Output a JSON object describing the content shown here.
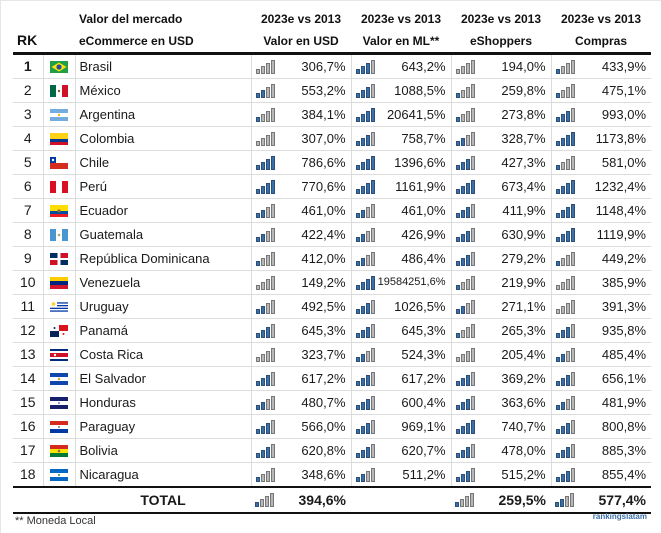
{
  "header": {
    "rk": "RK",
    "name_line1": "Valor del mercado",
    "name_line2": "eCommerce en USD",
    "columns": [
      {
        "line1": "2023e vs 2013",
        "line2": "Valor en USD"
      },
      {
        "line1": "2023e vs 2013",
        "line2": "Valor en ML**"
      },
      {
        "line1": "2023e vs 2013",
        "line2": "eShoppers"
      },
      {
        "line1": "2023e vs 2013",
        "line2": "Compras"
      }
    ]
  },
  "colors": {
    "signal_on": "#3b6fa8",
    "signal_off": "#b7b7b7",
    "brand": "#3b6fa8"
  },
  "rows": [
    {
      "rk": "1",
      "country": "Brasil",
      "flag": "brazil-flag",
      "values": [
        "306,7%",
        "643,2%",
        "194,0%",
        "433,9%"
      ],
      "signal": [
        0,
        3,
        0,
        1
      ]
    },
    {
      "rk": "2",
      "country": "México",
      "flag": "mexico-flag",
      "values": [
        "553,2%",
        "1088,5%",
        "259,8%",
        "475,1%"
      ],
      "signal": [
        2,
        3,
        1,
        1
      ]
    },
    {
      "rk": "3",
      "country": "Argentina",
      "flag": "argentina-flag",
      "values": [
        "384,1%",
        "20641,5%",
        "273,8%",
        "993,0%"
      ],
      "signal": [
        1,
        4,
        1,
        3
      ]
    },
    {
      "rk": "4",
      "country": "Colombia",
      "flag": "colombia-flag",
      "values": [
        "307,0%",
        "758,7%",
        "328,7%",
        "1173,8%"
      ],
      "signal": [
        0,
        3,
        2,
        4
      ]
    },
    {
      "rk": "5",
      "country": "Chile",
      "flag": "chile-flag",
      "values": [
        "786,6%",
        "1396,6%",
        "427,3%",
        "581,0%"
      ],
      "signal": [
        4,
        4,
        3,
        1
      ]
    },
    {
      "rk": "6",
      "country": "Perú",
      "flag": "peru-flag",
      "values": [
        "770,6%",
        "1161,9%",
        "673,4%",
        "1232,4%"
      ],
      "signal": [
        4,
        4,
        4,
        4
      ]
    },
    {
      "rk": "7",
      "country": "Ecuador",
      "flag": "ecuador-flag",
      "values": [
        "461,0%",
        "461,0%",
        "411,9%",
        "1148,4%"
      ],
      "signal": [
        2,
        2,
        3,
        4
      ]
    },
    {
      "rk": "8",
      "country": "Guatemala",
      "flag": "guatemala-flag",
      "values": [
        "422,4%",
        "426,9%",
        "630,9%",
        "1119,9%"
      ],
      "signal": [
        2,
        2,
        3,
        4
      ]
    },
    {
      "rk": "9",
      "country": "República Dominicana",
      "flag": "dominican-republic-flag",
      "values": [
        "412,0%",
        "486,4%",
        "279,2%",
        "449,2%"
      ],
      "signal": [
        1,
        2,
        3,
        1
      ]
    },
    {
      "rk": "10",
      "country": "Venezuela",
      "flag": "venezuela-flag",
      "values": [
        "149,2%",
        "19584251,6%",
        "219,9%",
        "385,9%"
      ],
      "signal": [
        0,
        4,
        1,
        0
      ]
    },
    {
      "rk": "11",
      "country": "Uruguay",
      "flag": "uruguay-flag",
      "values": [
        "492,5%",
        "1026,5%",
        "271,1%",
        "391,3%"
      ],
      "signal": [
        2,
        3,
        2,
        0
      ]
    },
    {
      "rk": "12",
      "country": "Panamá",
      "flag": "panama-flag",
      "values": [
        "645,3%",
        "645,3%",
        "265,3%",
        "935,8%"
      ],
      "signal": [
        3,
        3,
        1,
        3
      ]
    },
    {
      "rk": "13",
      "country": "Costa Rica",
      "flag": "costa-rica-flag",
      "values": [
        "323,7%",
        "524,3%",
        "205,4%",
        "485,4%"
      ],
      "signal": [
        0,
        2,
        0,
        2
      ]
    },
    {
      "rk": "14",
      "country": "El Salvador",
      "flag": "el-salvador-flag",
      "values": [
        "617,2%",
        "617,2%",
        "369,2%",
        "656,1%"
      ],
      "signal": [
        3,
        3,
        3,
        3
      ]
    },
    {
      "rk": "15",
      "country": "Honduras",
      "flag": "honduras-flag",
      "values": [
        "480,7%",
        "600,4%",
        "363,6%",
        "481,9%"
      ],
      "signal": [
        2,
        3,
        3,
        2
      ]
    },
    {
      "rk": "16",
      "country": "Paraguay",
      "flag": "paraguay-flag",
      "values": [
        "566,0%",
        "969,1%",
        "740,7%",
        "800,8%"
      ],
      "signal": [
        3,
        3,
        4,
        3
      ]
    },
    {
      "rk": "17",
      "country": "Bolivia",
      "flag": "bolivia-flag",
      "values": [
        "620,8%",
        "620,7%",
        "478,0%",
        "885,3%"
      ],
      "signal": [
        3,
        3,
        3,
        3
      ]
    },
    {
      "rk": "18",
      "country": "Nicaragua",
      "flag": "nicaragua-flag",
      "values": [
        "348,6%",
        "511,2%",
        "515,2%",
        "855,4%"
      ],
      "signal": [
        1,
        2,
        3,
        3
      ]
    }
  ],
  "total": {
    "label": "TOTAL",
    "values": [
      "394,6%",
      "",
      "259,5%",
      "577,4%"
    ],
    "signal": [
      1,
      null,
      1,
      2
    ]
  },
  "footer": {
    "note": "** Moneda Local",
    "brand": "rankingslatam"
  }
}
